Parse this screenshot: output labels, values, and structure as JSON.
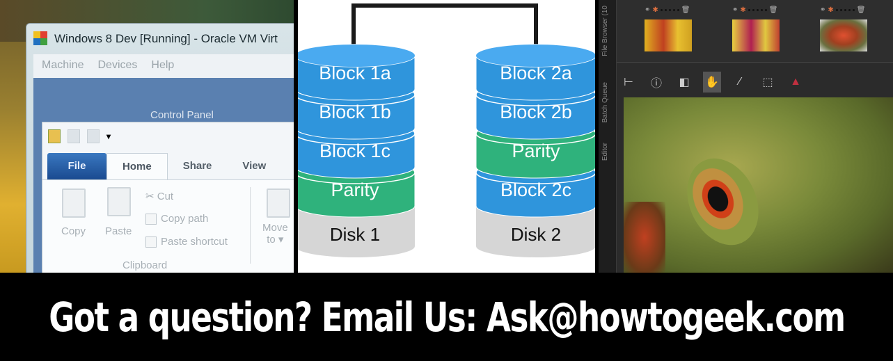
{
  "virtualbox": {
    "title": "Windows 8 Dev [Running] - Oracle VM Virt",
    "menu": [
      "Machine",
      "Devices",
      "Help"
    ],
    "address": "Control Panel"
  },
  "explorer": {
    "tabs": [
      "File",
      "Home",
      "Share",
      "View"
    ],
    "ribbon": {
      "copy": "Copy",
      "paste": "Paste",
      "cut": "Cut",
      "copy_path": "Copy path",
      "paste_shortcut": "Paste shortcut",
      "group": "Clipboard",
      "move_to": "Move",
      "move_to_2": "to ▾"
    }
  },
  "raid": {
    "disk1": {
      "label": "Disk 1",
      "blocks": [
        "Block 1a",
        "Block 1b",
        "Block 1c",
        "Parity"
      ]
    },
    "disk2": {
      "label": "Disk 2",
      "blocks": [
        "Block 2a",
        "Block 2b",
        "Parity",
        "Block 2c"
      ]
    },
    "colors": {
      "data_block": "#2f95dc",
      "parity_block": "#2fb27c",
      "disk": "#d6d6d6"
    }
  },
  "editor": {
    "side_tabs": [
      "File Browser (10",
      "Batch Queue",
      "Editor"
    ],
    "thumbnails": 3,
    "tools": [
      "crop-icon",
      "info-icon",
      "compare-icon",
      "hand-icon",
      "straighten-icon",
      "selection-icon",
      "color-icon"
    ]
  },
  "banner": {
    "text": "Got a question? Email Us: Ask@howtogeek.com"
  }
}
